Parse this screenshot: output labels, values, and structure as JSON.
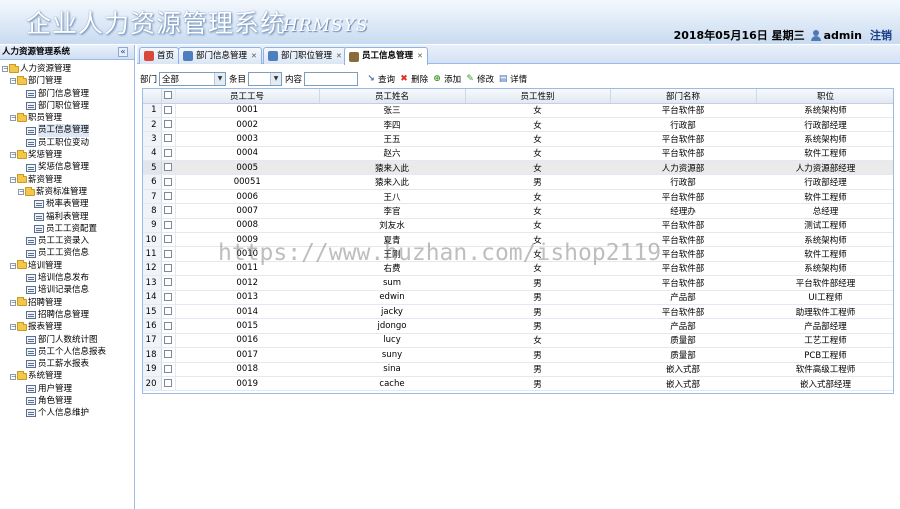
{
  "header": {
    "title": "企业人力资源管理系统",
    "subtitle": "HRMSYS",
    "datetime": "2018年05月16日 星期三",
    "username": "admin",
    "logout": "注销"
  },
  "sidebar": {
    "title": "人力资源管理系统",
    "collapse": "«",
    "nodes": [
      {
        "label": "人力资源管理",
        "level": 0,
        "type": "folder"
      },
      {
        "label": "部门管理",
        "level": 1,
        "type": "folder"
      },
      {
        "label": "部门信息管理",
        "level": 2,
        "type": "page"
      },
      {
        "label": "部门职位管理",
        "level": 2,
        "type": "page"
      },
      {
        "label": "职员管理",
        "level": 1,
        "type": "folder"
      },
      {
        "label": "员工信息管理",
        "level": 2,
        "type": "page",
        "selected": true
      },
      {
        "label": "员工职位变动",
        "level": 2,
        "type": "page"
      },
      {
        "label": "奖惩管理",
        "level": 1,
        "type": "folder"
      },
      {
        "label": "奖惩信息管理",
        "level": 2,
        "type": "page"
      },
      {
        "label": "薪资管理",
        "level": 1,
        "type": "folder"
      },
      {
        "label": "薪资标准管理",
        "level": 2,
        "type": "folder"
      },
      {
        "label": "税率表管理",
        "level": 3,
        "type": "page"
      },
      {
        "label": "福利表管理",
        "level": 3,
        "type": "page"
      },
      {
        "label": "员工工资配置",
        "level": 3,
        "type": "page"
      },
      {
        "label": "员工工资录入",
        "level": 2,
        "type": "page"
      },
      {
        "label": "员工工资信息",
        "level": 2,
        "type": "page"
      },
      {
        "label": "培训管理",
        "level": 1,
        "type": "folder"
      },
      {
        "label": "培训信息发布",
        "level": 2,
        "type": "page"
      },
      {
        "label": "培训记录信息",
        "level": 2,
        "type": "page"
      },
      {
        "label": "招聘管理",
        "level": 1,
        "type": "folder"
      },
      {
        "label": "招聘信息管理",
        "level": 2,
        "type": "page"
      },
      {
        "label": "报表管理",
        "level": 1,
        "type": "folder"
      },
      {
        "label": "部门人数统计图",
        "level": 2,
        "type": "page"
      },
      {
        "label": "员工个人信息报表",
        "level": 2,
        "type": "page"
      },
      {
        "label": "员工薪水报表",
        "level": 2,
        "type": "page"
      },
      {
        "label": "系统管理",
        "level": 1,
        "type": "folder"
      },
      {
        "label": "用户管理",
        "level": 2,
        "type": "page"
      },
      {
        "label": "角色管理",
        "level": 2,
        "type": "page"
      },
      {
        "label": "个人信息维护",
        "level": 2,
        "type": "page"
      }
    ]
  },
  "tabs": [
    {
      "label": "首页",
      "icon": "home-icon",
      "closable": false,
      "active": false
    },
    {
      "label": "部门信息管理",
      "icon": "grid-icon",
      "closable": true,
      "active": false
    },
    {
      "label": "部门职位管理",
      "icon": "grid-icon",
      "closable": true,
      "active": false
    },
    {
      "label": "员工信息管理",
      "icon": "user-icon",
      "closable": true,
      "active": true
    }
  ],
  "toolbar": {
    "dept_label": "部门",
    "dept_value": "全部",
    "item_label": "条目",
    "item_value": "",
    "content_label": "内容",
    "content_value": "",
    "query": "查询",
    "delete": "删除",
    "add": "添加",
    "edit": "修改",
    "detail": "详情"
  },
  "table": {
    "columns": [
      "员工工号",
      "员工姓名",
      "员工性别",
      "部门名称",
      "职位"
    ],
    "rows": [
      [
        "0001",
        "张三",
        "女",
        "平台软件部",
        "系统架构师"
      ],
      [
        "0002",
        "李四",
        "女",
        "行政部",
        "行政部经理"
      ],
      [
        "0003",
        "王五",
        "女",
        "平台软件部",
        "系统架构师"
      ],
      [
        "0004",
        "赵六",
        "女",
        "平台软件部",
        "软件工程师"
      ],
      [
        "0005",
        "猿来入此",
        "女",
        "人力资源部",
        "人力资源部经理"
      ],
      [
        "00051",
        "猿来入此",
        "男",
        "行政部",
        "行政部经理"
      ],
      [
        "0006",
        "王八",
        "女",
        "平台软件部",
        "软件工程师"
      ],
      [
        "0007",
        "李官",
        "女",
        "经理办",
        "总经理"
      ],
      [
        "0008",
        "刘友水",
        "女",
        "平台软件部",
        "测试工程师"
      ],
      [
        "0009",
        "夏青",
        "女",
        "平台软件部",
        "系统架构师"
      ],
      [
        "0010",
        "王刚",
        "女",
        "平台软件部",
        "软件工程师"
      ],
      [
        "0011",
        "右费",
        "女",
        "平台软件部",
        "系统架构师"
      ],
      [
        "0012",
        "sum",
        "男",
        "平台软件部",
        "平台软件部经理"
      ],
      [
        "0013",
        "edwin",
        "男",
        "产品部",
        "UI工程师"
      ],
      [
        "0014",
        "jacky",
        "男",
        "平台软件部",
        "助理软件工程师"
      ],
      [
        "0015",
        "jdongo",
        "男",
        "产品部",
        "产品部经理"
      ],
      [
        "0016",
        "lucy",
        "女",
        "质量部",
        "工艺工程师"
      ],
      [
        "0017",
        "suny",
        "男",
        "质量部",
        "PCB工程师"
      ],
      [
        "0018",
        "sina",
        "男",
        "嵌入式部",
        "软件高级工程师"
      ],
      [
        "0019",
        "cache",
        "男",
        "嵌入式部",
        "嵌入式部经理"
      ]
    ],
    "highlighted_row": 5
  },
  "watermark": "https://www.huzhan.com/ishop2119"
}
